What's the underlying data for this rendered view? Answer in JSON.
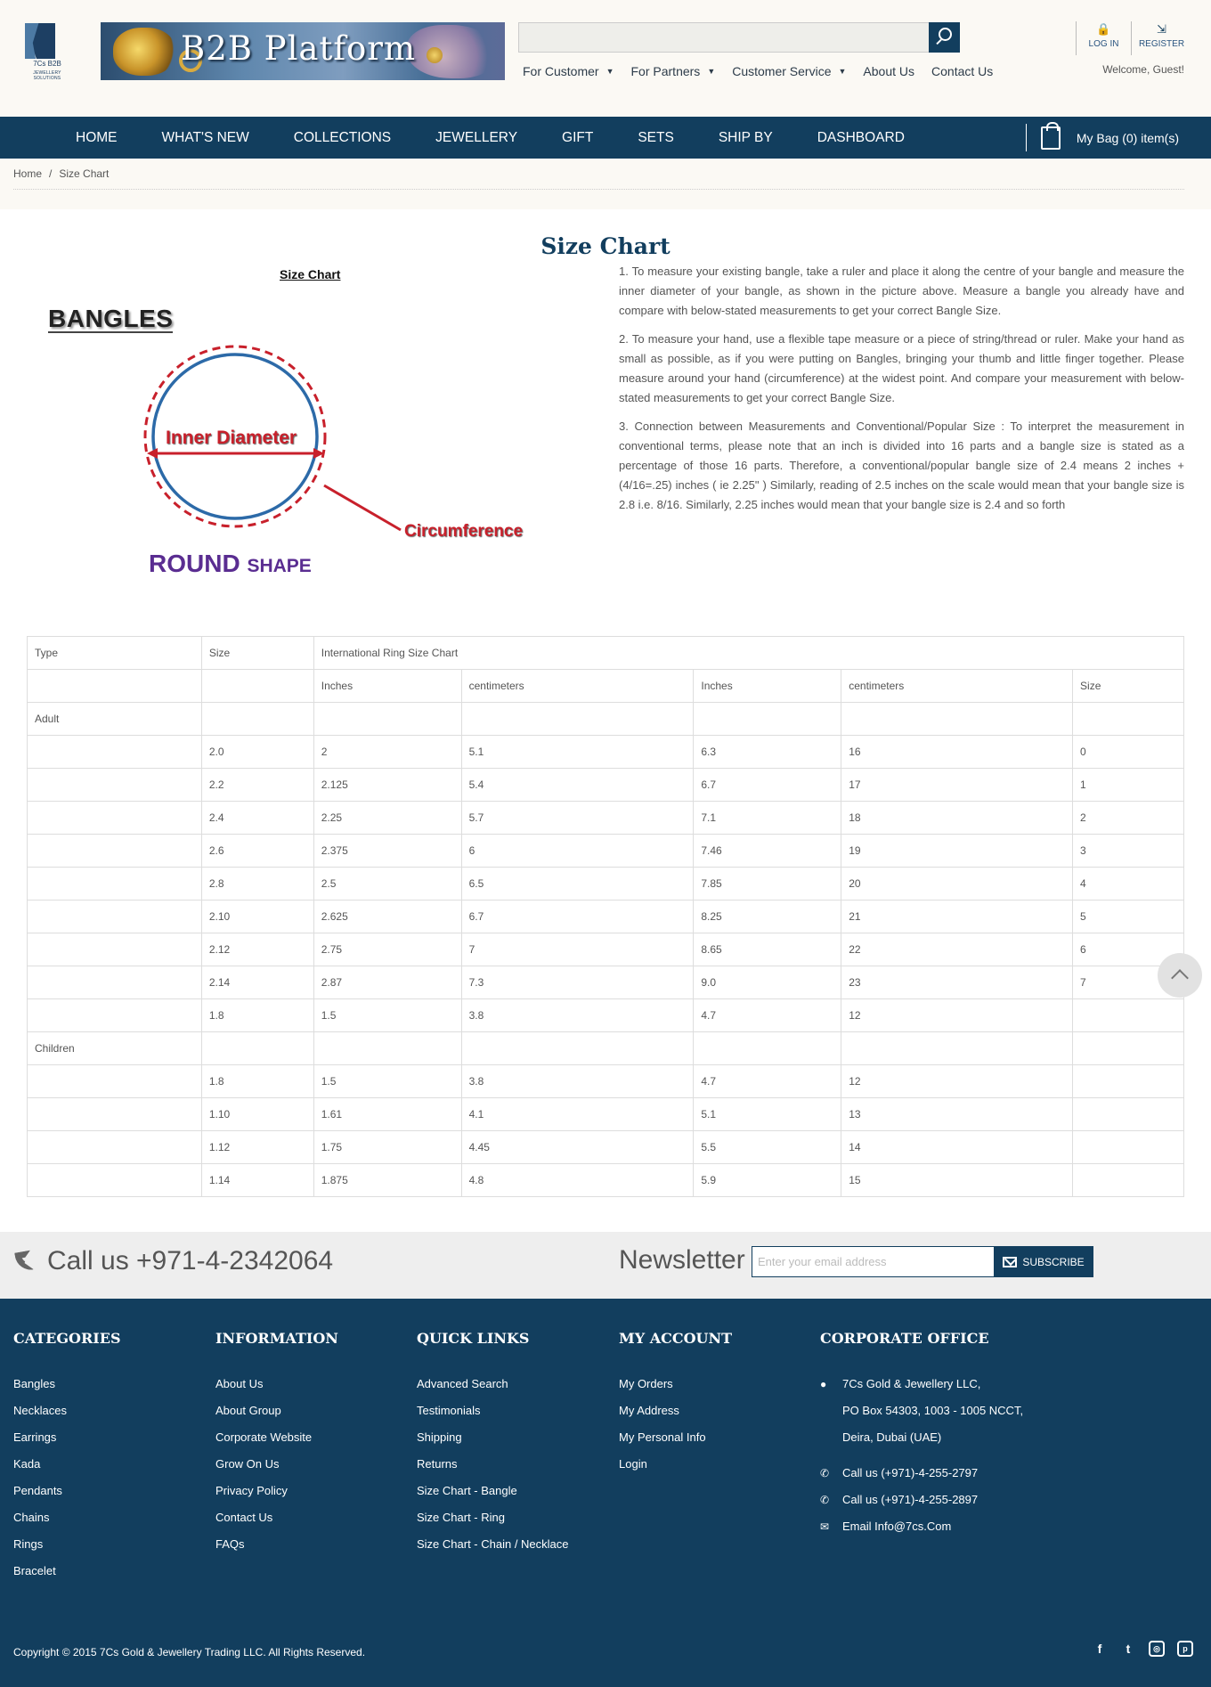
{
  "brand": {
    "logo_text": "7Cs B2B",
    "logo_sub": "JEWELLERY SOLUTIONS",
    "banner_title": "B2B Platform"
  },
  "header": {
    "search_placeholder": "",
    "top_nav": [
      {
        "label": "For Customer",
        "has_caret": true
      },
      {
        "label": "For Partners",
        "has_caret": true
      },
      {
        "label": "Customer Service",
        "has_caret": true
      },
      {
        "label": "About Us",
        "has_caret": false
      },
      {
        "label": "Contact Us",
        "has_caret": false
      }
    ],
    "login": "LOG IN",
    "register": "REGISTER",
    "welcome": "Welcome, Guest!"
  },
  "main_nav": [
    "HOME",
    "WHAT'S NEW",
    "COLLECTIONS",
    "JEWELLERY",
    "GIFT",
    "SETS",
    "SHIP BY",
    "DASHBOARD"
  ],
  "bag": {
    "label": "My Bag (0) item(s)"
  },
  "breadcrumb": {
    "home": "Home",
    "separator": "/",
    "current": "Size Chart"
  },
  "page": {
    "title": "Size Chart",
    "figure": {
      "title": "Size Chart",
      "heading": "BANGLES",
      "inner_label": "Inner Diameter",
      "circ_label": "Circumference",
      "shape_big": "ROUND",
      "shape_small": "SHAPE"
    },
    "instructions": [
      "1. To measure your existing bangle, take a ruler and place it along the centre of your bangle and measure the inner diameter of your bangle, as shown in the picture above. Measure a bangle you already have and compare with below-stated measurements to get your correct Bangle Size.",
      "2. To measure your hand, use a flexible tape measure or a piece of string/thread or ruler. Make your hand as small as possible, as if you were putting on Bangles, bringing your thumb and little finger together. Please measure around your hand (circumference) at the widest point. And compare your measurement with below-stated measurements to get your correct Bangle Size.",
      "3. Connection between Measurements and Conventional/Popular Size : To interpret the measurement in conventional terms, please note that an inch is divided into 16 parts and a bangle size is stated as a percentage of those 16 parts. Therefore, a conventional/popular bangle size of 2.4 means 2 inches + (4/16=.25) inches ( ie 2.25\" ) Similarly, reading of 2.5 inches on the scale would mean that your bangle size is 2.8 i.e. 8/16. Similarly, 2.25 inches would mean that your bangle size is 2.4 and so forth"
    ]
  },
  "table": {
    "header": {
      "type": "Type",
      "size": "Size",
      "intl": "International Ring Size Chart"
    },
    "subheader": [
      "",
      "",
      "Inches",
      "centimeters",
      "Inches",
      "centimeters",
      "Size"
    ],
    "rows": [
      [
        "Adult",
        "",
        "",
        "",
        "",
        "",
        ""
      ],
      [
        "",
        "2.0",
        "2",
        "5.1",
        "6.3",
        "16",
        "0"
      ],
      [
        "",
        "2.2",
        "2.125",
        "5.4",
        "6.7",
        "17",
        "1"
      ],
      [
        "",
        "2.4",
        "2.25",
        "5.7",
        "7.1",
        "18",
        "2"
      ],
      [
        "",
        "2.6",
        "2.375",
        "6",
        "7.46",
        "19",
        "3"
      ],
      [
        "",
        "2.8",
        "2.5",
        "6.5",
        "7.85",
        "20",
        "4"
      ],
      [
        "",
        "2.10",
        "2.625",
        "6.7",
        "8.25",
        "21",
        "5"
      ],
      [
        "",
        "2.12",
        "2.75",
        "7",
        "8.65",
        "22",
        "6"
      ],
      [
        "",
        "2.14",
        "2.87",
        "7.3",
        "9.0",
        "23",
        "7"
      ],
      [
        "",
        "1.8",
        "1.5",
        "3.8",
        "4.7",
        "12",
        ""
      ],
      [
        "Children",
        "",
        "",
        "",
        "",
        "",
        ""
      ],
      [
        "",
        "1.8",
        "1.5",
        "3.8",
        "4.7",
        "12",
        ""
      ],
      [
        "",
        "1.10",
        "1.61",
        "4.1",
        "5.1",
        "13",
        ""
      ],
      [
        "",
        "1.12",
        "1.75",
        "4.45",
        "5.5",
        "14",
        ""
      ],
      [
        "",
        "1.14",
        "1.875",
        "4.8",
        "5.9",
        "15",
        ""
      ]
    ]
  },
  "newsletter": {
    "call": "Call us +971-4-2342064",
    "title": "Newsletter",
    "placeholder": "Enter your email address",
    "button": "SUBSCRIBE"
  },
  "footer": {
    "categories": {
      "title": "CATEGORIES",
      "items": [
        "Bangles",
        "Necklaces",
        "Earrings",
        "Kada",
        "Pendants",
        "Chains",
        "Rings",
        "Bracelet"
      ]
    },
    "information": {
      "title": "INFORMATION",
      "items": [
        "About Us",
        "About Group",
        "Corporate Website",
        "Grow On Us",
        "Privacy Policy",
        "Contact Us",
        "FAQs"
      ]
    },
    "quick_links": {
      "title": "QUICK LINKS",
      "items": [
        "Advanced Search",
        "Testimonials",
        "Shipping",
        "Returns",
        "Size Chart - Bangle",
        "Size Chart - Ring",
        "Size Chart - Chain / Necklace"
      ]
    },
    "my_account": {
      "title": "MY ACCOUNT",
      "items": [
        "My Orders",
        "My Address",
        "My Personal Info",
        "Login"
      ]
    },
    "office": {
      "title": "CORPORATE OFFICE",
      "address": [
        "7Cs Gold & Jewellery LLC,",
        "PO Box 54303, 1003 - 1005 NCCT,",
        "Deira, Dubai (UAE)"
      ],
      "phone1": "Call us (+971)-4-255-2797",
      "phone2": "Call us (+971)-4-255-2897",
      "email": "Email Info@7cs.Com"
    },
    "copyright": "Copyright © 2015 7Cs Gold & Jewellery Trading LLC. All Rights Reserved.",
    "social": [
      {
        "icon": "facebook-icon",
        "glyph": "f"
      },
      {
        "icon": "twitter-icon",
        "glyph": "t"
      },
      {
        "icon": "instagram-icon",
        "glyph": "◎"
      },
      {
        "icon": "pinterest-icon",
        "glyph": "p"
      }
    ]
  },
  "colors": {
    "primary": "#123e5e",
    "header_bg": "#fbf9f4",
    "accent_red": "#c8202b",
    "shape_purple": "#5a2d91"
  }
}
